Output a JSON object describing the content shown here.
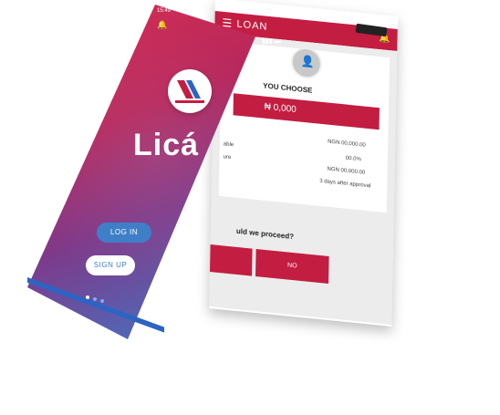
{
  "landing": {
    "status_time": "15:49",
    "brand_name": "Licá",
    "login_label": "LOG IN",
    "signup_label": "SIGN UP",
    "signal_text": "▮▮▮ ▬",
    "logo_colors": {
      "primary": "#c31d42",
      "secondary": "#2d64c3"
    }
  },
  "loan": {
    "title": "LOAN",
    "choose_label": "YOU CHOOSE",
    "amount_prefix": "₦ 0,000",
    "rows": [
      {
        "label": "",
        "value": "NGN 00,000.00"
      },
      {
        "label": "able",
        "value": "00.0%"
      },
      {
        "label": "ure",
        "value": "NGN 00,000.00"
      },
      {
        "label": "",
        "value": "3 days after approval"
      }
    ],
    "question": "uld we proceed?",
    "no_label": "NO"
  },
  "colors": {
    "accent": "#c31d42",
    "blue": "#3f7fc7",
    "gradient_top": "#d72f53",
    "gradient_bottom": "#3f79c8"
  }
}
